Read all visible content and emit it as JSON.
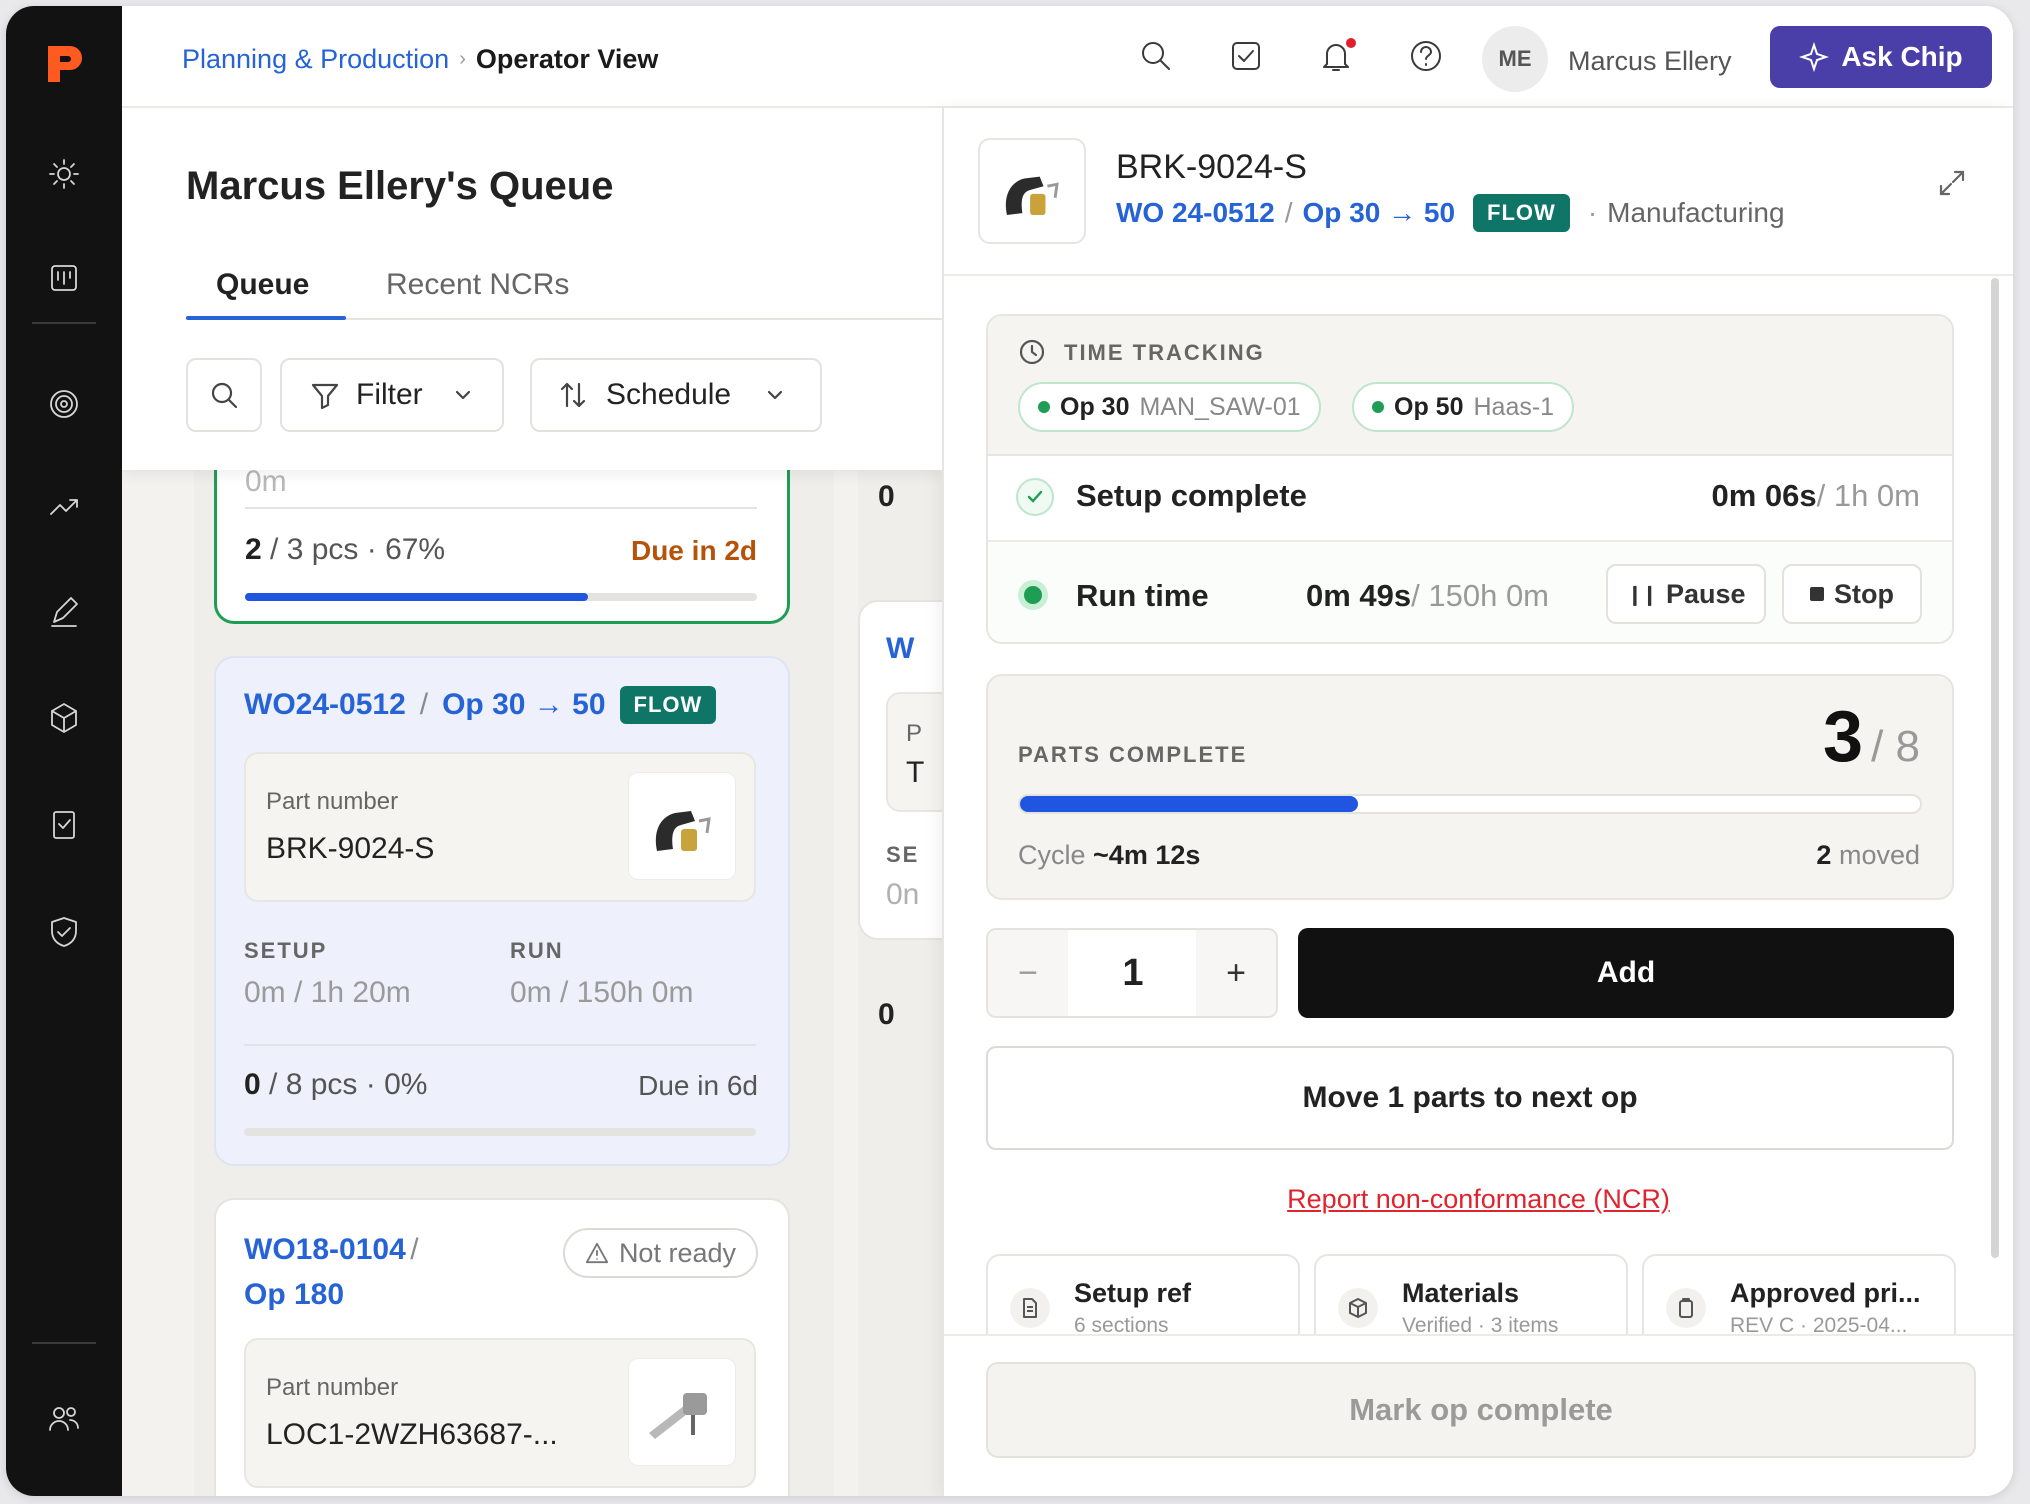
{
  "breadcrumb": {
    "parent": "Planning & Production",
    "current": "Operator View"
  },
  "user": {
    "initials": "ME",
    "name": "Marcus Ellery"
  },
  "ask_chip": "Ask Chip",
  "queue": {
    "title": "Marcus Ellery's Queue",
    "tabs": [
      "Queue",
      "Recent NCRs"
    ],
    "filter_label": "Filter",
    "schedule_label": "Schedule"
  },
  "cards": [
    {
      "partial_top": "0m",
      "count": "2",
      "total": "/ 3 pcs · 67%",
      "due": "Due in 2d",
      "progress": 0.67
    },
    {
      "wo": "WO24-0512",
      "op": "Op 30 → 50",
      "badge": "FLOW",
      "part_label": "Part number",
      "part": "BRK-9024-S",
      "setup_label": "SETUP",
      "setup_val": "0m / 1h 20m",
      "run_label": "RUN",
      "run_val": "0m / 150h 0m",
      "count": "0",
      "total": "/ 8 pcs · 0%",
      "due": "Due in 6d",
      "progress": 0.0
    },
    {
      "wo": "WO18-0104",
      "op": "Op 180",
      "status": "Not ready",
      "part_label": "Part number",
      "part": "LOC1-2WZH63687-..."
    }
  ],
  "col2": {
    "a": "0",
    "b": "W",
    "c": "P",
    "d": "T",
    "e": "SE",
    "f": "0n",
    "g": "0"
  },
  "panel": {
    "part": "BRK-9024-S",
    "wo": "WO 24-0512",
    "op": "Op 30 → 50",
    "badge": "FLOW",
    "dept": "Manufacturing",
    "time_tracking_label": "TIME TRACKING",
    "chips": [
      {
        "op": "Op 30",
        "machine": "MAN_SAW-01"
      },
      {
        "op": "Op 50",
        "machine": "Haas-1"
      }
    ],
    "setup": {
      "label": "Setup complete",
      "value": "0m 06s",
      "target": "/ 1h 0m"
    },
    "run": {
      "label": "Run time",
      "value": "0m 49s",
      "target": "/ 150h 0m",
      "pause": "Pause",
      "stop": "Stop"
    },
    "parts": {
      "label": "PARTS COMPLETE",
      "done": "3",
      "total": "/ 8",
      "progress": 0.375,
      "cycle_label": "Cycle",
      "cycle": "~4m 12s",
      "moved_count": "2",
      "moved_label": "moved"
    },
    "qty": {
      "minus": "−",
      "value": "1",
      "plus": "+"
    },
    "add": "Add",
    "move": "Move 1 parts to next op",
    "ncr": "Report non-conformance (NCR)",
    "tiles": [
      {
        "title": "Setup ref",
        "sub": "6 sections"
      },
      {
        "title": "Materials",
        "sub": "Verified · 3 items"
      },
      {
        "title": "Approved pri...",
        "sub": "REV C · 2025-04..."
      }
    ],
    "mark_complete": "Mark op complete"
  }
}
